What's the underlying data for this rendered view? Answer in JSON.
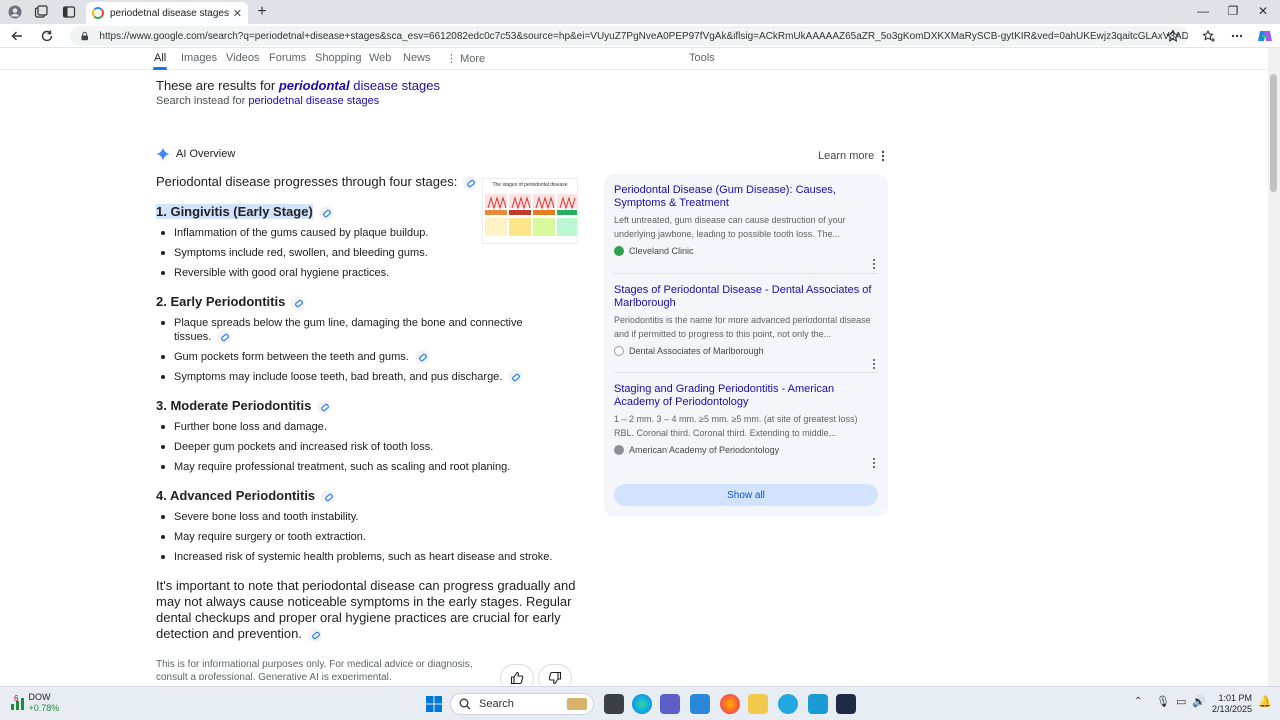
{
  "browser": {
    "tab_title": "periodetnal disease stages - Goo",
    "url": "https://www.google.com/search?q=periodetnal+disease+stages&sca_esv=6612082edc0c7c53&source=hp&ei=VUyuZ7PgNveA0PEP97fVgAk&iflsig=ACkRmUkAAAAAZ65aZR_5o3gKomDXKXMaRySCB-gytKIR&ved=0ahUKEwjz3qaitcGLAxV3ADQIHfdbFZQQ..."
  },
  "search_tabs": [
    "All",
    "Images",
    "Videos",
    "Forums",
    "Shopping",
    "Web",
    "News",
    "More",
    "Tools"
  ],
  "correction": {
    "prefix": "These are results for ",
    "corrected_bold": "periodontal",
    "corrected_rest": " disease stages",
    "instead_prefix": "Search instead for ",
    "instead_link": "periodetnal disease stages"
  },
  "ai": {
    "label": "AI Overview",
    "learn_more": "Learn more",
    "intro": "Periodontal disease progresses through four stages:",
    "thumb_title": "The stages of periodontal disease",
    "stages": [
      {
        "title": "1. Gingivitis (Early Stage)",
        "bullets": [
          "Inflammation of the gums caused by plaque buildup.",
          "Symptoms include red, swollen, and bleeding gums.",
          "Reversible with good oral hygiene practices."
        ]
      },
      {
        "title": "2. Early Periodontitis",
        "bullets": [
          "Plaque spreads below the gum line, damaging the bone and connective tissues.",
          "Gum pockets form between the teeth and gums.",
          "Symptoms may include loose teeth, bad breath, and pus discharge."
        ]
      },
      {
        "title": "3. Moderate Periodontitis",
        "bullets": [
          "Further bone loss and damage.",
          "Deeper gum pockets and increased risk of tooth loss.",
          "May require professional treatment, such as scaling and root planing."
        ]
      },
      {
        "title": "4. Advanced Periodontitis",
        "bullets": [
          "Severe bone loss and tooth instability.",
          "May require surgery or tooth extraction.",
          "Increased risk of systemic health problems, such as heart disease and stroke."
        ]
      }
    ],
    "summary": "It's important to note that periodontal disease can progress gradually and may not always cause noticeable symptoms in the early stages. Regular dental checkups and proper oral hygiene practices are crucial for early detection and prevention.",
    "disclaimer": "This is for informational purposes only. For medical advice or diagnosis, consult a professional. Generative AI is experimental."
  },
  "sources": [
    {
      "title": "Periodontal Disease (Gum Disease): Causes, Symptoms & Treatment",
      "snippet": "Left untreated, gum disease can cause destruction of your underlying jawbone, leading to possible tooth loss. The...",
      "site": "Cleveland Clinic",
      "color": "#2e9e4f"
    },
    {
      "title": "Stages of Periodontal Disease - Dental Associates of Marlborough",
      "snippet": "Periodontitis is the name for more advanced periodontal disease and if permitted to progress to this point, not only the...",
      "site": "Dental Associates of Marlborough",
      "color": "#6b7280"
    },
    {
      "title": "Staging and Grading Periodontitis - American Academy of Periodontology",
      "snippet": "1 – 2 mm. 3 – 4 mm. ≥5 mm. ≥5 mm. (at site of greatest loss) RBL. Coronal third. Coronal third. Extending to middle...",
      "site": "American Academy of Periodontology",
      "color": "#8a8f98"
    }
  ],
  "show_all": "Show all",
  "taskbar": {
    "badge": "6",
    "ticker": "DOW",
    "change": "+0.78%",
    "search": "Search",
    "time": "1:01 PM",
    "date": "2/13/2025"
  }
}
